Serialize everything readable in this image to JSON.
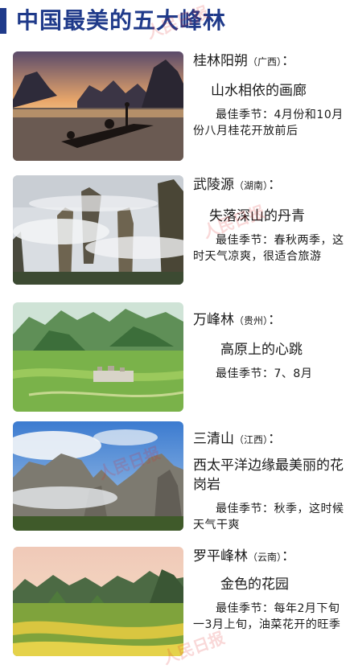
{
  "header": {
    "title": "中国最美的五大峰林"
  },
  "watermark": {
    "text": "人民日报"
  },
  "items": [
    {
      "name": "桂林阳朔",
      "region": "（广西）",
      "colon": "：",
      "slogan": "山水相依的画廊",
      "season": "最佳季节：4月份和10月份八月桂花开放前后",
      "image_icon": "karst-river-fishing-icon"
    },
    {
      "name": "武陵源",
      "region": "（湖南）",
      "colon": "：",
      "slogan": "失落深山的丹青",
      "season": "最佳季节：春秋两季，这时天气凉爽，很适合旅游",
      "image_icon": "sandstone-pillars-icon"
    },
    {
      "name": "万峰林",
      "region": "（贵州）",
      "colon": "：",
      "slogan": "高原上的心跳",
      "season": "最佳季节：7、8月",
      "image_icon": "green-peaks-village-icon"
    },
    {
      "name": "三清山",
      "region": "（江西）",
      "colon": "：",
      "slogan": "西太平洋边缘最美丽的花岗岩",
      "season": "最佳季节：秋季，这时候天气干爽",
      "image_icon": "granite-peaks-clouds-icon"
    },
    {
      "name": "罗平峰林",
      "region": "（云南）",
      "colon": "：",
      "slogan": "金色的花园",
      "season": "最佳季节：每年2月下旬一3月上旬，油菜花开的旺季",
      "image_icon": "golden-fields-peaks-icon"
    }
  ]
}
